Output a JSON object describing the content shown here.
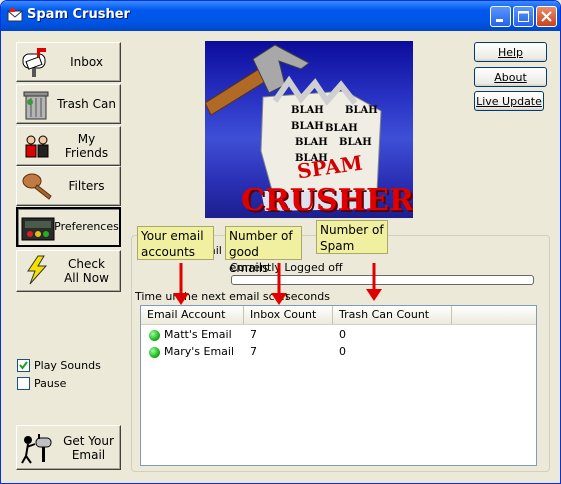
{
  "window": {
    "title": "Spam Crusher"
  },
  "nav": [
    {
      "label": "Inbox"
    },
    {
      "label": "Trash Can"
    },
    {
      "label": "My Friends"
    },
    {
      "label": "Filters"
    },
    {
      "label": "Preferences"
    },
    {
      "label": "Check All Now"
    }
  ],
  "logo": {
    "blah": "BLAH",
    "spam": "SPAM",
    "crusher": "CRUSHER"
  },
  "side_buttons": {
    "help": "Help",
    "about": "About",
    "live_update": "Live Update"
  },
  "status": {
    "group_label_fragment": "ail C",
    "connection": "Currently Logged off",
    "scan_timer_left": "Time unt",
    "scan_timer_right": "he next email scan",
    "scan_timer_end": "seconds"
  },
  "accounts_table": {
    "columns": [
      "Email Account",
      "Inbox Count",
      "Trash Can Count"
    ],
    "rows": [
      {
        "account": "Matt's Email",
        "inbox": "7",
        "trash": "0"
      },
      {
        "account": "Mary's Email",
        "inbox": "7",
        "trash": "0"
      }
    ]
  },
  "options": {
    "play_sounds": "Play Sounds",
    "pause": "Pause",
    "play_sounds_checked": true,
    "pause_checked": false
  },
  "get_email": {
    "label": "Get Your Email"
  },
  "annotations": {
    "accounts": "Your email accounts",
    "good": "Number of good emails",
    "spam": "Number of Spam"
  },
  "colors": {
    "arrow": "#E00000",
    "note_bg": "#F0F0A0",
    "titlebar": "#0055E5"
  }
}
